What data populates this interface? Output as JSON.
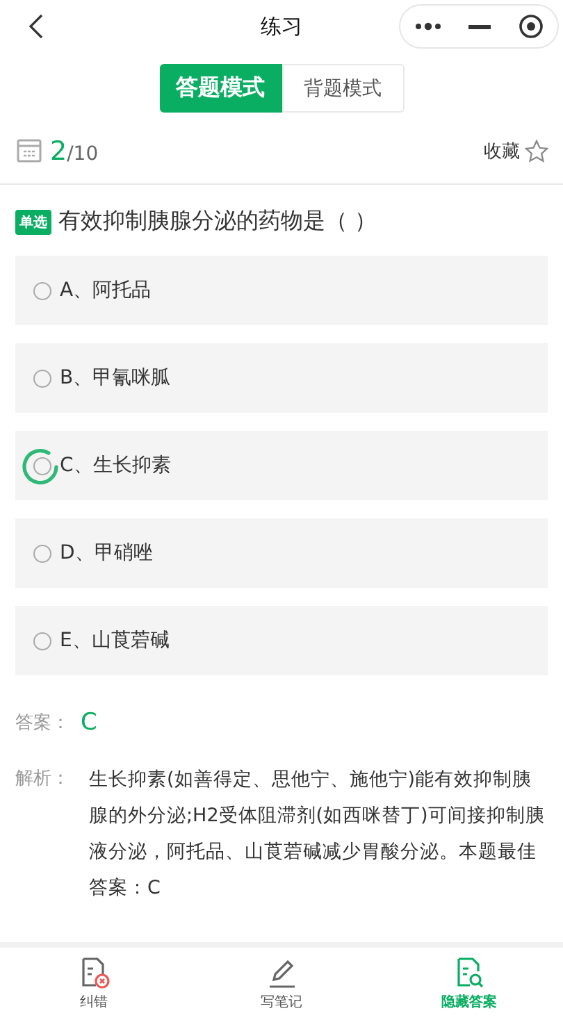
{
  "nav": {
    "title": "练习"
  },
  "mode_tabs": [
    {
      "label": "答题模式",
      "selected": true
    },
    {
      "label": "背题模式",
      "selected": false
    }
  ],
  "progress": {
    "current": "2",
    "total": "/10",
    "favorite_label": "收藏",
    "favorited": false
  },
  "question": {
    "type_badge": "单选",
    "text": "有效抑制胰腺分泌的药物是（ ）"
  },
  "options": [
    {
      "label": "A、阿托品",
      "selected": false,
      "pressed": false
    },
    {
      "label": "B、甲氰咪胍",
      "selected": false,
      "pressed": false
    },
    {
      "label": "C、生长抑素",
      "selected": false,
      "pressed": true
    },
    {
      "label": "D、甲硝唑",
      "selected": false,
      "pressed": false
    },
    {
      "label": "E、山莨菪碱",
      "selected": false,
      "pressed": false
    }
  ],
  "answer": {
    "label": "答案：",
    "value": "C"
  },
  "analysis": {
    "label": "解析：",
    "text": "生长抑素(如善得定、思他宁、施他宁)能有效抑制胰腺的外分泌;H2受体阻滞剂(如西咪替丁)可间接抑制胰液分泌，阿托品、山莨菪碱减少胃酸分泌。本题最佳答案：C"
  },
  "bottom_bar": [
    {
      "kind": "report",
      "label": "纠错",
      "selected": false
    },
    {
      "kind": "note",
      "label": "写笔记",
      "selected": false
    },
    {
      "kind": "hide",
      "label": "隐藏答案",
      "selected": true
    }
  ]
}
